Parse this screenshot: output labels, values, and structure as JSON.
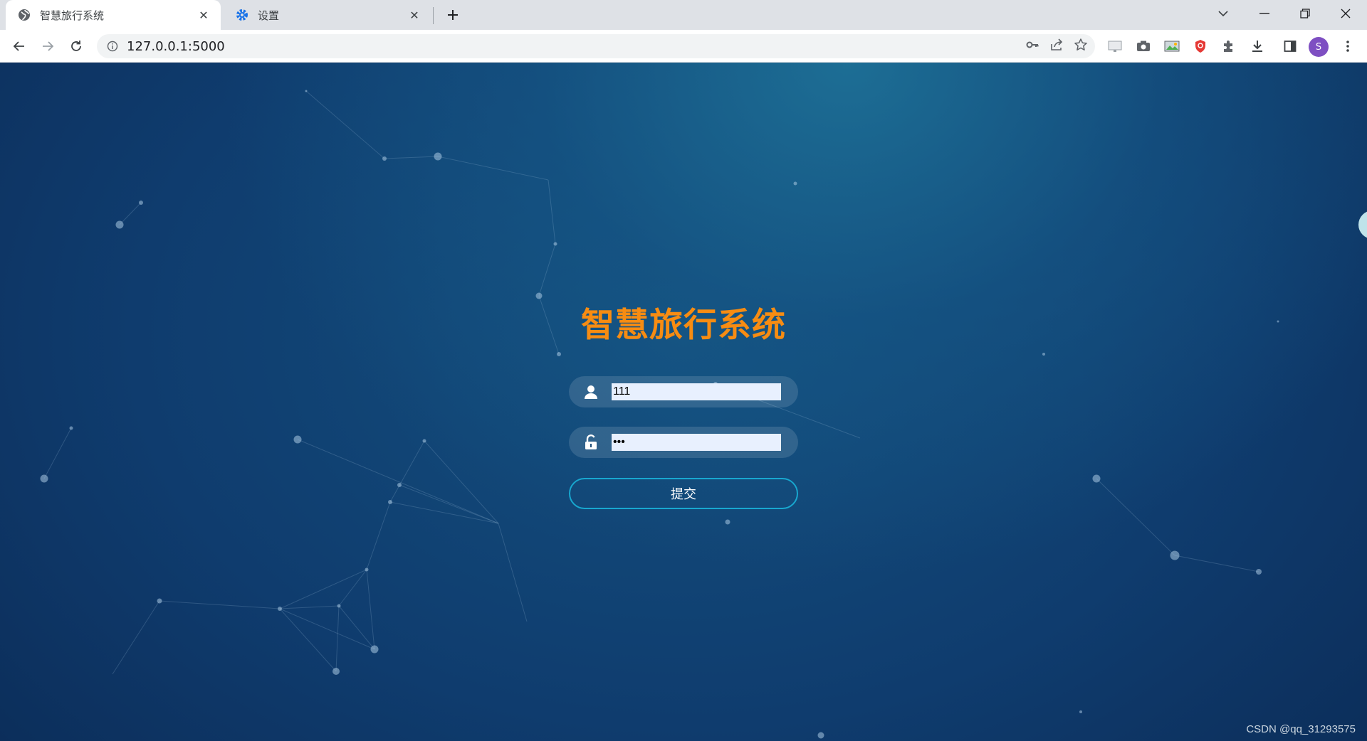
{
  "browser": {
    "tabs": [
      {
        "title": "智慧旅行系统",
        "icon": "globe-icon",
        "active": true
      },
      {
        "title": "设置",
        "icon": "gear-icon",
        "active": false
      }
    ],
    "url": "127.0.0.1:5000",
    "profile_initial": "S"
  },
  "login": {
    "title": "智慧旅行系统",
    "username_value": "111",
    "password_value": "111",
    "submit_label": "提交"
  },
  "watermark": "CSDN @qq_31293575",
  "colors": {
    "title": "#f78c12",
    "submit_border": "#18a7cf",
    "input_bg": "#e8f0fe",
    "background": "#0f3c6e"
  }
}
